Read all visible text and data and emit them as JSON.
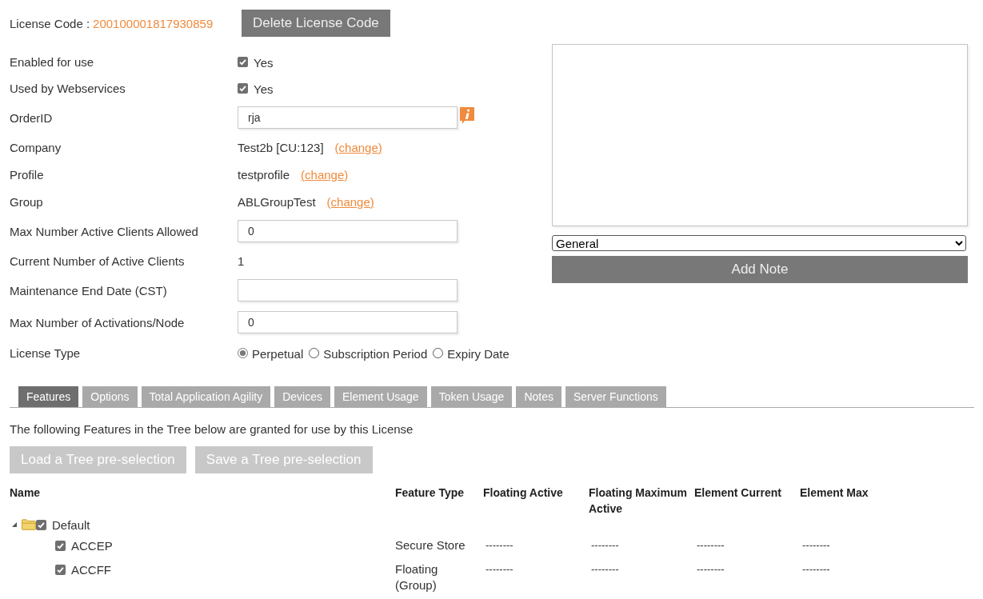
{
  "license": {
    "label": "License Code :",
    "code": "200100001817930859"
  },
  "delete_button": {
    "label": "Delete License Code"
  },
  "fields": [
    {
      "kind": "checkbox",
      "label": "Enabled for use",
      "checked": true,
      "text": "Yes"
    },
    {
      "kind": "checkbox",
      "label": "Used by Webservices",
      "checked": true,
      "text": "Yes"
    },
    {
      "kind": "input",
      "label": "OrderID",
      "value": "rja",
      "info": true
    },
    {
      "kind": "link",
      "label": "Company",
      "value": "Test2b [CU:123]",
      "link": "(change)"
    },
    {
      "kind": "link",
      "label": "Profile",
      "value": "testprofile",
      "link": "(change)"
    },
    {
      "kind": "link",
      "label": "Group",
      "value": "ABLGroupTest",
      "link": "(change)"
    },
    {
      "kind": "input",
      "label": "Max Number Active Clients Allowed",
      "value": "0"
    },
    {
      "kind": "text",
      "label": "Current Number of Active Clients",
      "value": "1"
    },
    {
      "kind": "input",
      "label": "Maintenance End Date (CST)"
    },
    {
      "kind": "input",
      "label": "Max Number of Activations/Node",
      "value": "0"
    },
    {
      "kind": "radio",
      "label": "License Type",
      "options": [
        {
          "label": "Perpetual",
          "selected": true
        },
        {
          "label": "Subscription Period",
          "selected": false
        },
        {
          "label": "Expiry Date",
          "selected": false
        }
      ]
    }
  ],
  "notes": {
    "category": "General",
    "button": "Add Note"
  },
  "tabs": [
    {
      "label": "Features",
      "selected": true
    },
    {
      "label": "Options",
      "selected": false
    },
    {
      "label": "Total Application Agility",
      "selected": false
    },
    {
      "label": "Devices",
      "selected": false
    },
    {
      "label": "Element Usage",
      "selected": false
    },
    {
      "label": "Token Usage",
      "selected": false
    },
    {
      "label": "Notes",
      "selected": false
    },
    {
      "label": "Server Functions",
      "selected": false
    }
  ],
  "features": {
    "intro": "The following Features in the Tree below are granted for use by this License",
    "buttons": [
      {
        "label": "Load a Tree pre-selection",
        "disabled": true
      },
      {
        "label": "Save a Tree pre-selection",
        "disabled": true
      }
    ],
    "columns": [
      "Name",
      "Feature Type",
      "Floating Active",
      "Floating Maximum Active",
      "Element Current",
      "Element Max"
    ],
    "tree": [
      {
        "name": "Default",
        "checked": true,
        "expanded": true,
        "children": [
          {
            "name": "ACCEP",
            "checked": true,
            "feature_type": "Secure Store",
            "values": [
              "--------",
              "--------",
              "--------",
              "--------"
            ]
          },
          {
            "name": "ACCFF",
            "checked": true,
            "feature_type": "Floating (Group)",
            "values": [
              "--------",
              "--------",
              "--------",
              "--------"
            ]
          }
        ]
      }
    ]
  }
}
